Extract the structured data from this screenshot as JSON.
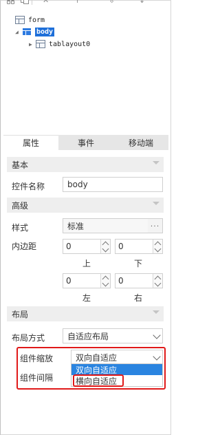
{
  "tree": {
    "form_label": "form",
    "body_label": "body",
    "table_label": "tablayout0"
  },
  "tabs": [
    {
      "label": "属性",
      "active": true
    },
    {
      "label": "事件",
      "active": false
    },
    {
      "label": "移动端",
      "active": false
    }
  ],
  "sections": {
    "basic": "基本",
    "advanced": "高级",
    "layout": "布局"
  },
  "basic": {
    "control_name_label": "控件名称",
    "control_name_value": "body"
  },
  "advanced": {
    "style_label": "样式",
    "style_value": "标准",
    "style_button": "···",
    "padding_label": "内边距",
    "padding_top": "0",
    "padding_bottom": "0",
    "padding_left": "0",
    "padding_right": "0",
    "caption_top": "上",
    "caption_bottom": "下",
    "caption_left": "左",
    "caption_right": "右"
  },
  "layout": {
    "layout_mode_label": "布局方式",
    "layout_mode_value": "自适应布局",
    "scale_label": "组件缩放",
    "scale_value": "双向自适应",
    "spacing_label": "组件间隔",
    "scale_options": [
      "双向自适应",
      "横向自适应"
    ],
    "highlighted_option_index": 0
  },
  "colors": {
    "accent": "#2a84e0",
    "annotation": "#e01818",
    "section_bg": "#eeeeee",
    "tab_inactive_bg": "#e6e6e6"
  }
}
